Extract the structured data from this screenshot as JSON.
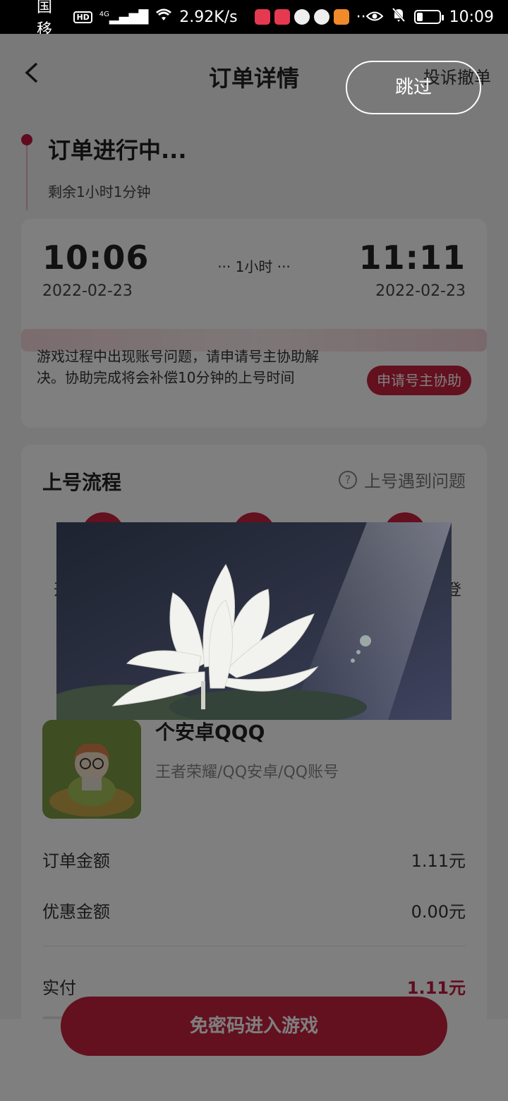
{
  "status_bar": {
    "carrier": "中国移动",
    "hd": "HD",
    "network": "4G",
    "speed": "2.92K/s",
    "time": "10:09"
  },
  "nav": {
    "title": "订单详情",
    "complain_label": "投诉撤单"
  },
  "order": {
    "status_title": "订单进行中...",
    "remaining": "剩余1小时1分钟",
    "start_time": "10:06",
    "start_date": "2022-02-23",
    "duration": "··· 1小时 ···",
    "end_time": "11:11",
    "end_date": "2022-02-23",
    "help_text": "游戏过程中出现账号问题，请申请号主协助解决。协助完成将会补偿10分钟的上号时间",
    "help_button": "申请号主协助"
  },
  "flow": {
    "title": "上号流程",
    "help_label": "上号遇到问题",
    "help_icon": "question-circle-icon",
    "step_left_fragment": "开",
    "step_right_fragment": "登"
  },
  "product": {
    "name": "个安卓QQQ",
    "path": "王者荣耀/QQ安卓/QQ账号"
  },
  "amounts": {
    "order_label": "订单金额",
    "order_value": "1.11元",
    "discount_label": "优惠金额",
    "discount_value": "0.00元",
    "paid_label": "实付",
    "paid_value": "1.11元"
  },
  "bottom": {
    "enter_button": "免密码进入游戏"
  },
  "overlay": {
    "skip_label": "跳过"
  },
  "colors": {
    "accent": "#c7203f",
    "background": "#f3f3f3"
  }
}
